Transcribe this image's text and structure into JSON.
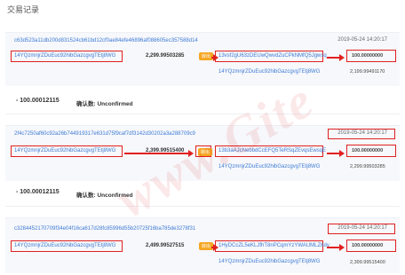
{
  "page": {
    "title": "交易记录"
  },
  "watermark": "www.Gite",
  "transactions": [
    {
      "hash": "c63d523a11db200d831524cb61bd12cf0ae84efe46896af088605ec357588d14",
      "time": "2019-05-24 14:20:17",
      "input_address": "14YQzmnjrZDuEuc92hibGazcgvgTEtj8WG",
      "input_amount": "2,299.99503285",
      "direction_label": "转出",
      "output_address": "13vsf2gU63zDEUwQwvdZuCPkNMfQ5Jgwsq",
      "output_amount": "100.00000000",
      "change_address": "14YQzmnjrZDuEuc92hibGazcgvgTEtj8WG",
      "change_amount": "2,199.99491170",
      "total": "- 100.00012115",
      "confirm_label": "确认数: Unconfirmed"
    },
    {
      "hash": "2f4c7250af60c92a26b744919317e631d75f9caf7df3142d30202a3a288709c9",
      "time": "2019-05-24 14:20:17",
      "input_address": "14YQzmnjrZDuEuc92hibGazcgvgTEtj8WG",
      "input_amount": "2,399.99515400",
      "direction_label": "转出",
      "output_address": "13b3aAJcNebbdCcEFQ5TeRSqZEvqsEwsqE",
      "output_amount": "100.00000000",
      "change_address": "14YQzmnjrZDuEuc92hibGazcgvgTEtj8WG",
      "change_amount": "2,299.99503285",
      "total": "- 100.00012115",
      "confirm_label": "确认数: Unconfirmed"
    },
    {
      "hash": "c3284452170709f34e04f16ca617d28fc85996d55b20725f16ba785de3278f31",
      "time": "2019-05-24 14:20:17",
      "input_address": "14YQzmnjrZDuEuc92hibGazcgvgTEtj8WG",
      "input_amount": "2,499.99527515",
      "direction_label": "转出",
      "output_address": "1HyDCcZL5eKLJfhT8nPCqmYzYWAUMLZ6dy",
      "output_amount": "100.00000000",
      "change_address": "14YQzmnjrZDuEuc92hibGazcgvgTEtj8WG",
      "change_amount": "2,399.99515400"
    }
  ]
}
